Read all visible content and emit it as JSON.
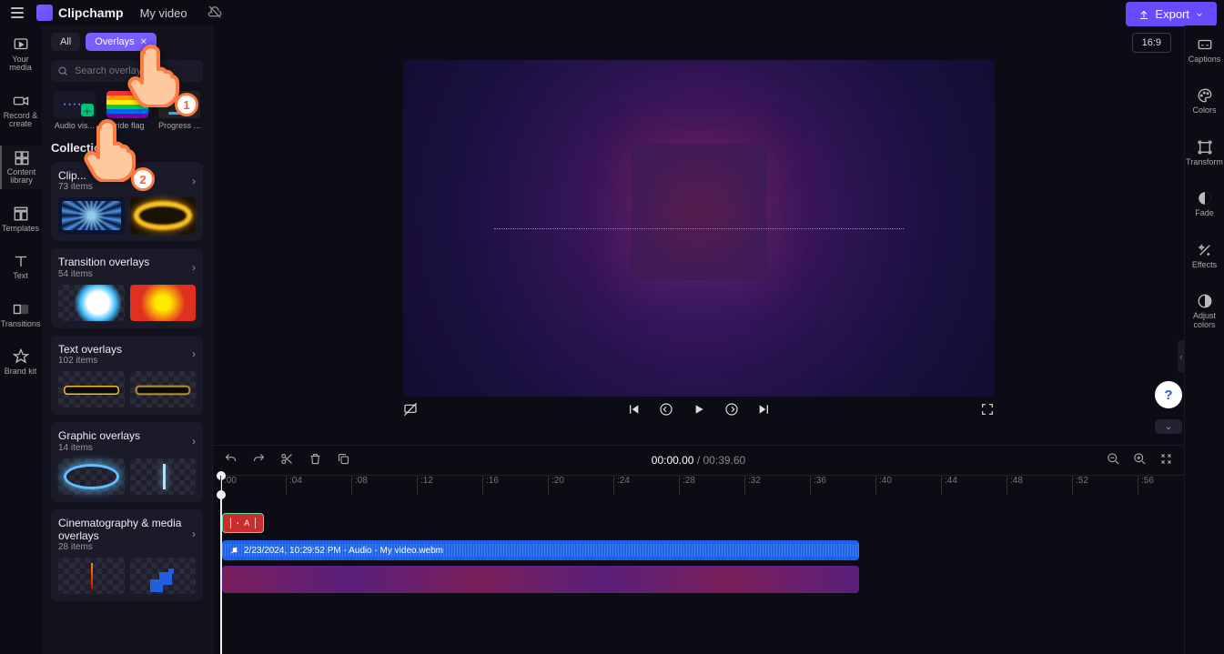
{
  "header": {
    "brand": "Clipchamp",
    "project": "My video",
    "export": "Export"
  },
  "rail": {
    "your_media": "Your media",
    "record": "Record & create",
    "content_library": "Content library",
    "templates": "Templates",
    "text": "Text",
    "transitions": "Transitions",
    "brand_kit": "Brand kit"
  },
  "panel": {
    "tab_all": "All",
    "tab_overlays": "Overlays",
    "search_ph": "Search overlays",
    "chips": {
      "audio_vis": "Audio vis...",
      "add": "Add ...",
      "pride": "Pride flag",
      "progress": "Progress ..."
    },
    "collections_head": "Collections",
    "collections": [
      {
        "title": "Clip...",
        "count": "73 items"
      },
      {
        "title": "Transition overlays",
        "count": "54 items"
      },
      {
        "title": "Text overlays",
        "count": "102 items"
      },
      {
        "title": "Graphic overlays",
        "count": "14 items"
      },
      {
        "title": "Cinematography & media overlays",
        "count": "28 items"
      }
    ]
  },
  "preview": {
    "ratio": "16:9"
  },
  "timeline": {
    "current": "00:00.00",
    "total": "00:39.60",
    "ticks": [
      ":00",
      ":04",
      ":08",
      ":12",
      ":16",
      ":20",
      ":24",
      ":28",
      ":32",
      ":36",
      ":40",
      ":44",
      ":48",
      ":52",
      ":56"
    ],
    "overlay_clip": "A",
    "audio_clip": "2/23/2024, 10:29:52 PM - Audio - My video.webm"
  },
  "rrail": {
    "captions": "Captions",
    "colors": "Colors",
    "transform": "Transform",
    "fade": "Fade",
    "effects": "Effects",
    "adjust": "Adjust colors"
  },
  "annotation": {
    "step1": "1",
    "step2": "2"
  },
  "help": "?"
}
